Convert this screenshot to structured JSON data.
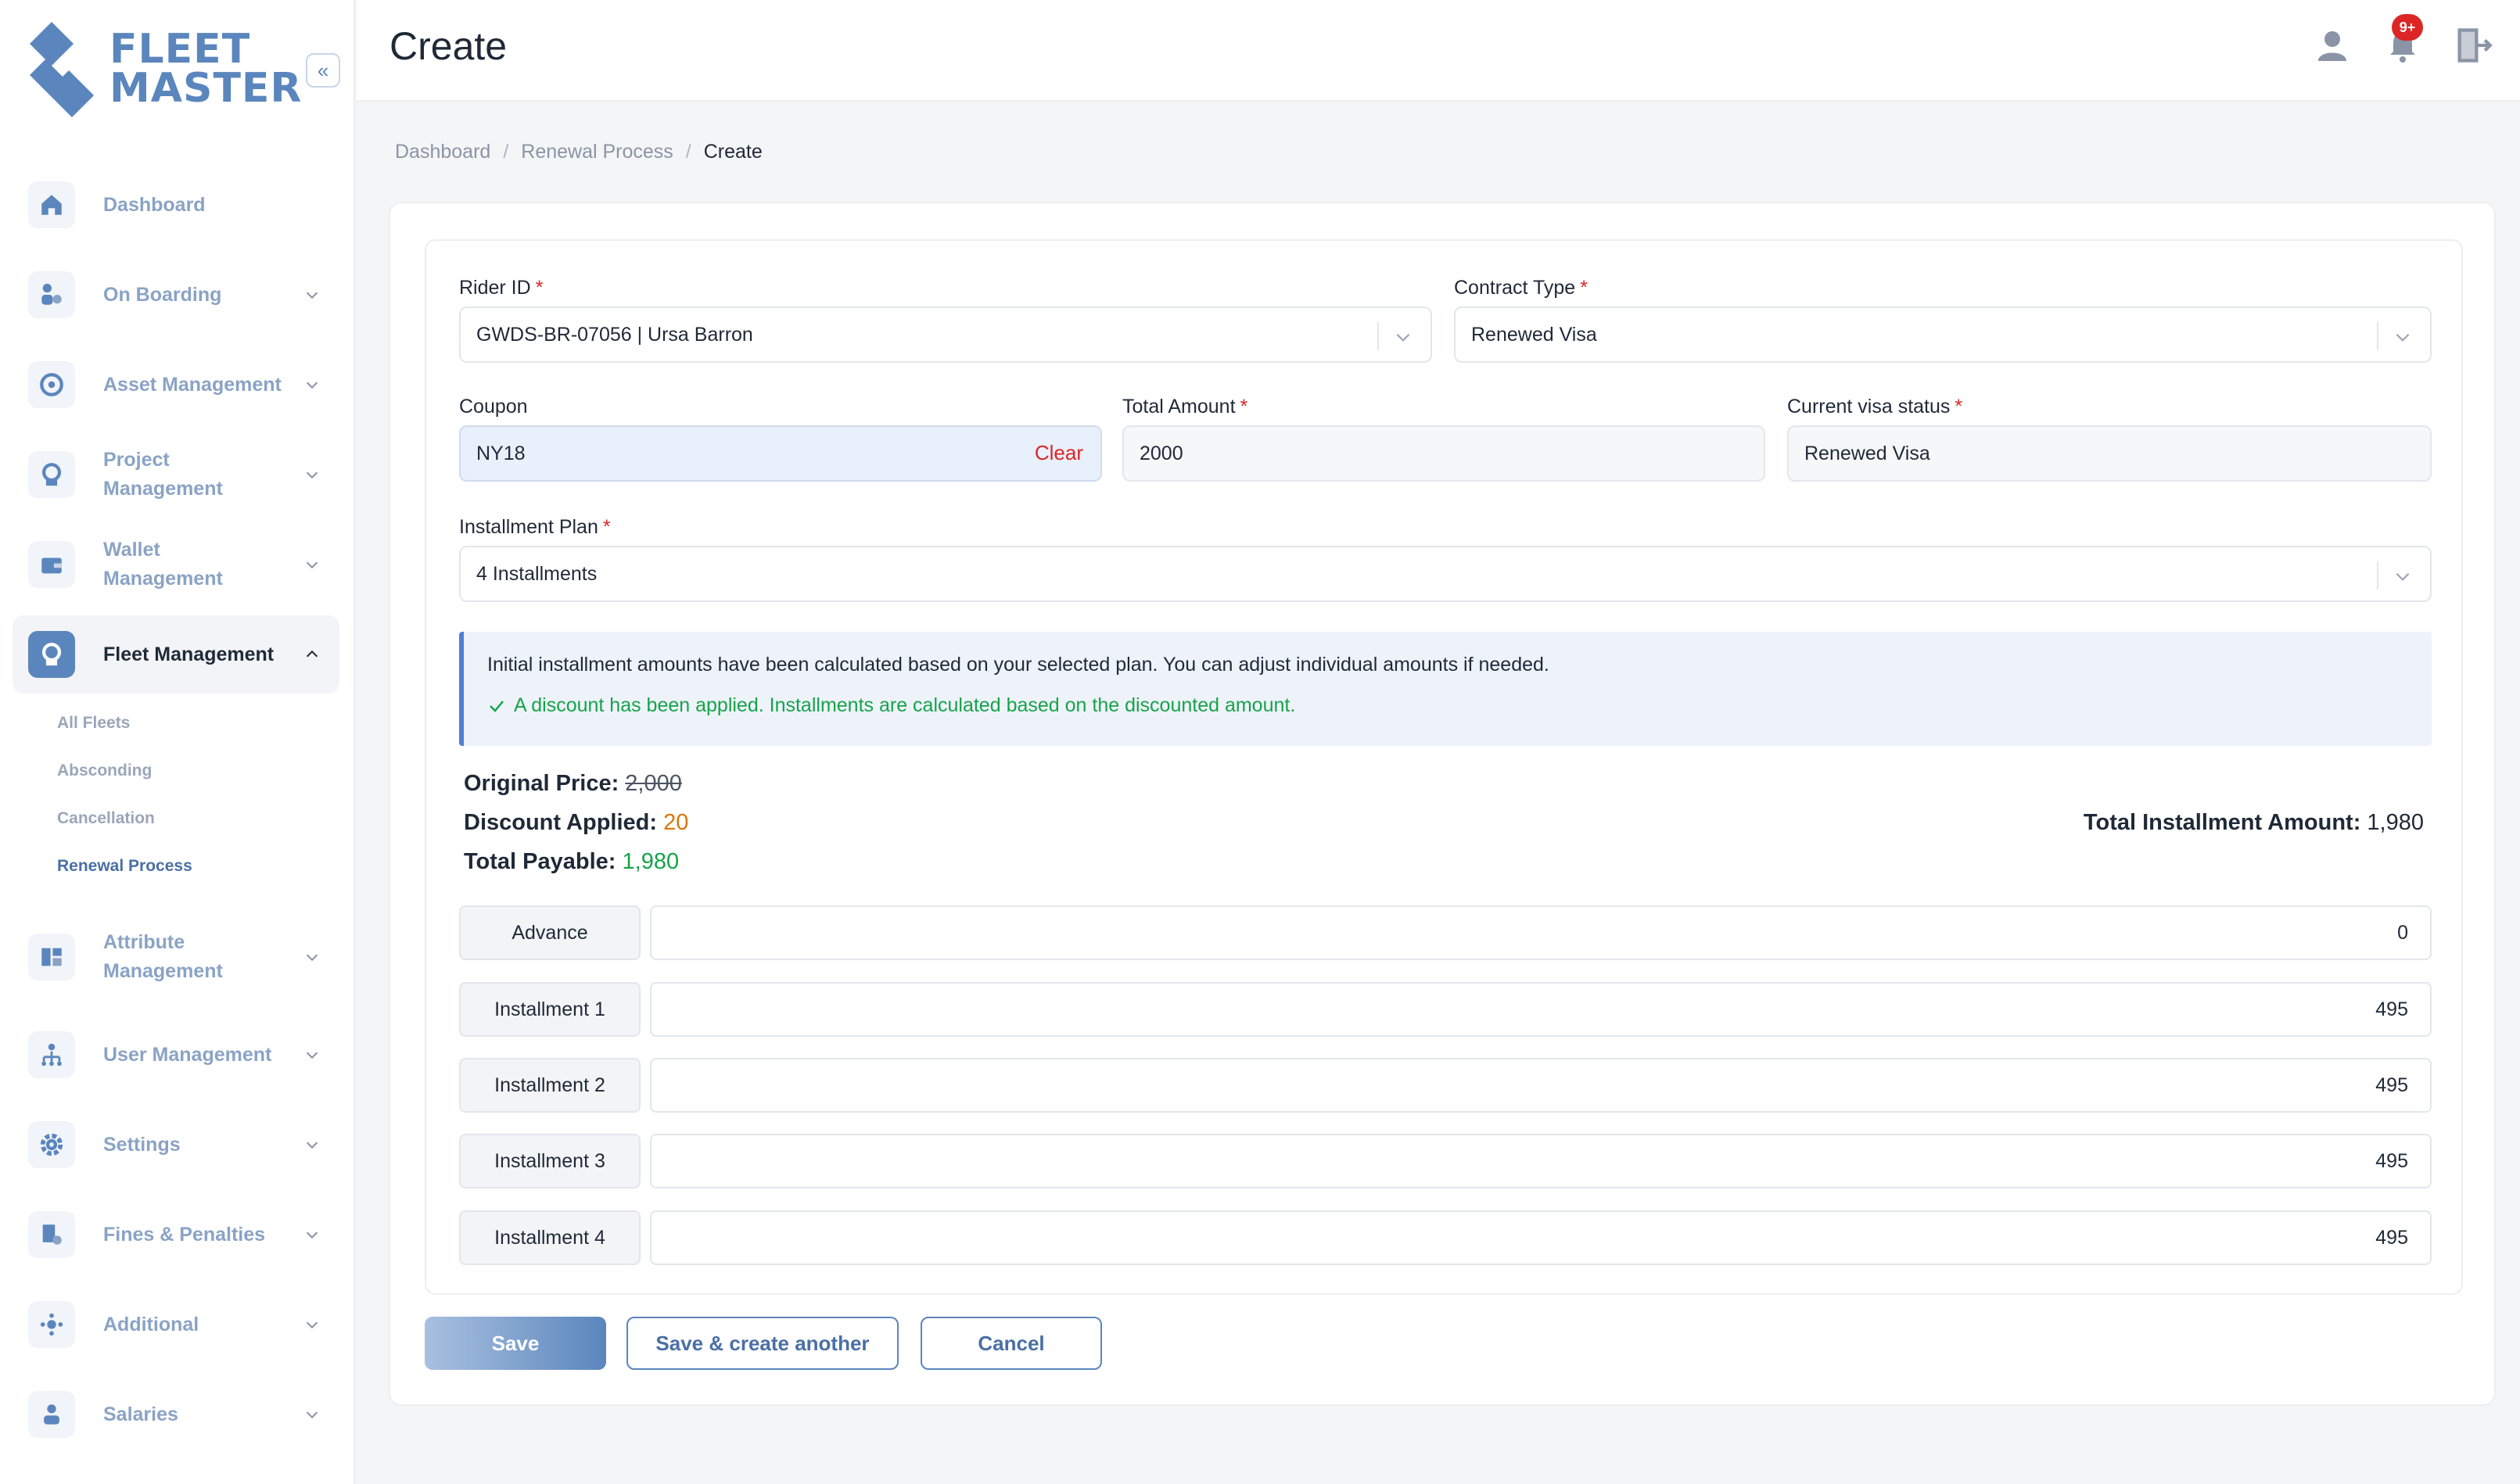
{
  "app": {
    "logo_line1": "FLEET",
    "logo_line2": "MASTER",
    "page_title": "Create",
    "notification_badge": "9+",
    "accent_color": "#5b86bd"
  },
  "sidebar": {
    "items": [
      {
        "label": "Dashboard",
        "icon": "home-icon"
      },
      {
        "label": "On Boarding",
        "icon": "onboarding-icon"
      },
      {
        "label": "Asset Management",
        "icon": "asset-icon"
      },
      {
        "label": "Project Management",
        "icon": "project-icon"
      },
      {
        "label": "Wallet Management",
        "icon": "wallet-icon"
      },
      {
        "label": "Fleet Management",
        "icon": "fleet-icon",
        "active": true
      },
      {
        "label": "Attribute Management",
        "icon": "attribute-icon"
      },
      {
        "label": "User Management",
        "icon": "users-icon"
      },
      {
        "label": "Settings",
        "icon": "gear-icon"
      },
      {
        "label": "Fines & Penalties",
        "icon": "fines-icon"
      },
      {
        "label": "Additional",
        "icon": "additional-icon"
      },
      {
        "label": "Salaries",
        "icon": "salaries-icon"
      }
    ],
    "fleet_sub": [
      "All Fleets",
      "Absconding",
      "Cancellation",
      "Renewal Process"
    ]
  },
  "breadcrumb": [
    "Dashboard",
    "Renewal Process",
    "Create"
  ],
  "form": {
    "rider_id": {
      "label": "Rider ID",
      "value": "GWDS-BR-07056 | Ursa Barron"
    },
    "contract_type": {
      "label": "Contract Type",
      "value": "Renewed Visa"
    },
    "coupon": {
      "label": "Coupon",
      "value": "NY18",
      "clear_label": "Clear"
    },
    "total_amount": {
      "label": "Total Amount",
      "value": "2000"
    },
    "visa_status": {
      "label": "Current visa status",
      "value": "Renewed Visa"
    },
    "installment_plan": {
      "label": "Installment Plan",
      "value": "4 Installments"
    },
    "required_mark": "*"
  },
  "info": {
    "line1": "Initial installment amounts have been calculated based on your selected plan. You can adjust individual amounts if needed.",
    "line2": "A discount has been applied. Installments are calculated based on the discounted amount."
  },
  "summary": {
    "original_label": "Original Price:",
    "original_value": "2,000",
    "discount_label": "Discount Applied:",
    "discount_value": "20",
    "payable_label": "Total Payable:",
    "payable_value": "1,980",
    "total_inst_label": "Total Installment Amount:",
    "total_inst_value": "1,980"
  },
  "installments": [
    {
      "label": "Advance",
      "value": "0"
    },
    {
      "label": "Installment 1",
      "value": "495"
    },
    {
      "label": "Installment 2",
      "value": "495"
    },
    {
      "label": "Installment 3",
      "value": "495"
    },
    {
      "label": "Installment 4",
      "value": "495"
    }
  ],
  "buttons": {
    "save": "Save",
    "save_another": "Save & create another",
    "cancel": "Cancel"
  }
}
